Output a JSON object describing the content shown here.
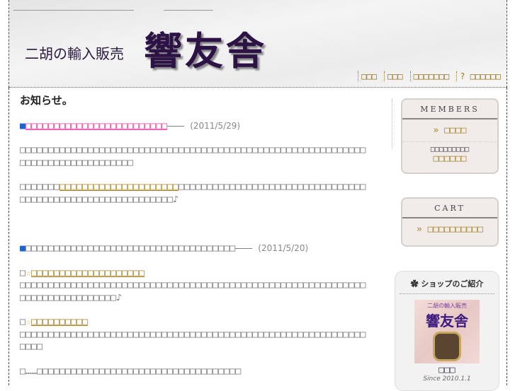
{
  "header": {
    "subtitle": "二胡の輸入販売",
    "logo": "響友舎",
    "nav": [
      "□□□",
      "□□□",
      "□□□□□□□",
      "? □□□□□□"
    ]
  },
  "main": {
    "title": "お知らせ。",
    "news": [
      {
        "bullet": "■",
        "headline": "□□□□□□□□□□□□□□□□□□□□□□□□□",
        "dash": "———",
        "date": "(2011/5/29)",
        "paragraphs": [
          {
            "text": "□□□□□□□□□□□□□□□□□□□□□□□□□□□□□□□□□□□□□□□□□□□□□□□□□□□□□□□□□□□□□□□□□□□□□□□□□□□□□□□□□"
          },
          {
            "pre": "□□□□□□□",
            "link": "□□□□□□□□□□□□□□□□□□□□□",
            "post": "□□□□□□□□□□□□□□□□□□□□□□□□□□□□□□□□□□□□□□□□□□□□□□□□□□□□□□□□□□□□♪"
          }
        ]
      },
      {
        "bullet": "■",
        "headline": "□□□□□□□□□□□□□□□□□□□□□□□□□□□□□□□□□□□□□",
        "dash": "———",
        "date": "(2011/5/20)",
        "items": [
          {
            "mark": "□",
            "star": "☆",
            "link": "□□□□□□□□□□□□□□□□□□□□",
            "body": "□□□□□□□□□□□□□□□□□□□□□□□□□□□□□□□□□□□□□□□□□□□□□□□□□□□□□□□□□□□□□□□□□□□□□□□□□□□□□□♪"
          },
          {
            "mark": "□",
            "star": "☆",
            "link": "□□□□□□□□□□",
            "body": "□□□□□□□□□□□□□□□□□□□□□□□□□□□□□□□□□□□□□□□□□□□□□□□□□□□□□□□□□□□□□□□□□"
          }
        ],
        "last": "□……□□□□□□□□□□□□□□□□□□□□□□□□□□□□□□□□□□□□"
      }
    ]
  },
  "sidebar": {
    "members": {
      "heading": "MEMBERS",
      "login": "» □□□□",
      "note": "□□□□□□□□□",
      "register": "□□□□□□"
    },
    "cart": {
      "heading": "CART",
      "view": "» □□□□□□□□□□"
    },
    "shop": {
      "heading": "ショップのご紹介",
      "image_sub": "二胡の輸入販売",
      "image_logo": "響友舎",
      "name": "□□□",
      "since": "Since 2010.1.1"
    }
  }
}
